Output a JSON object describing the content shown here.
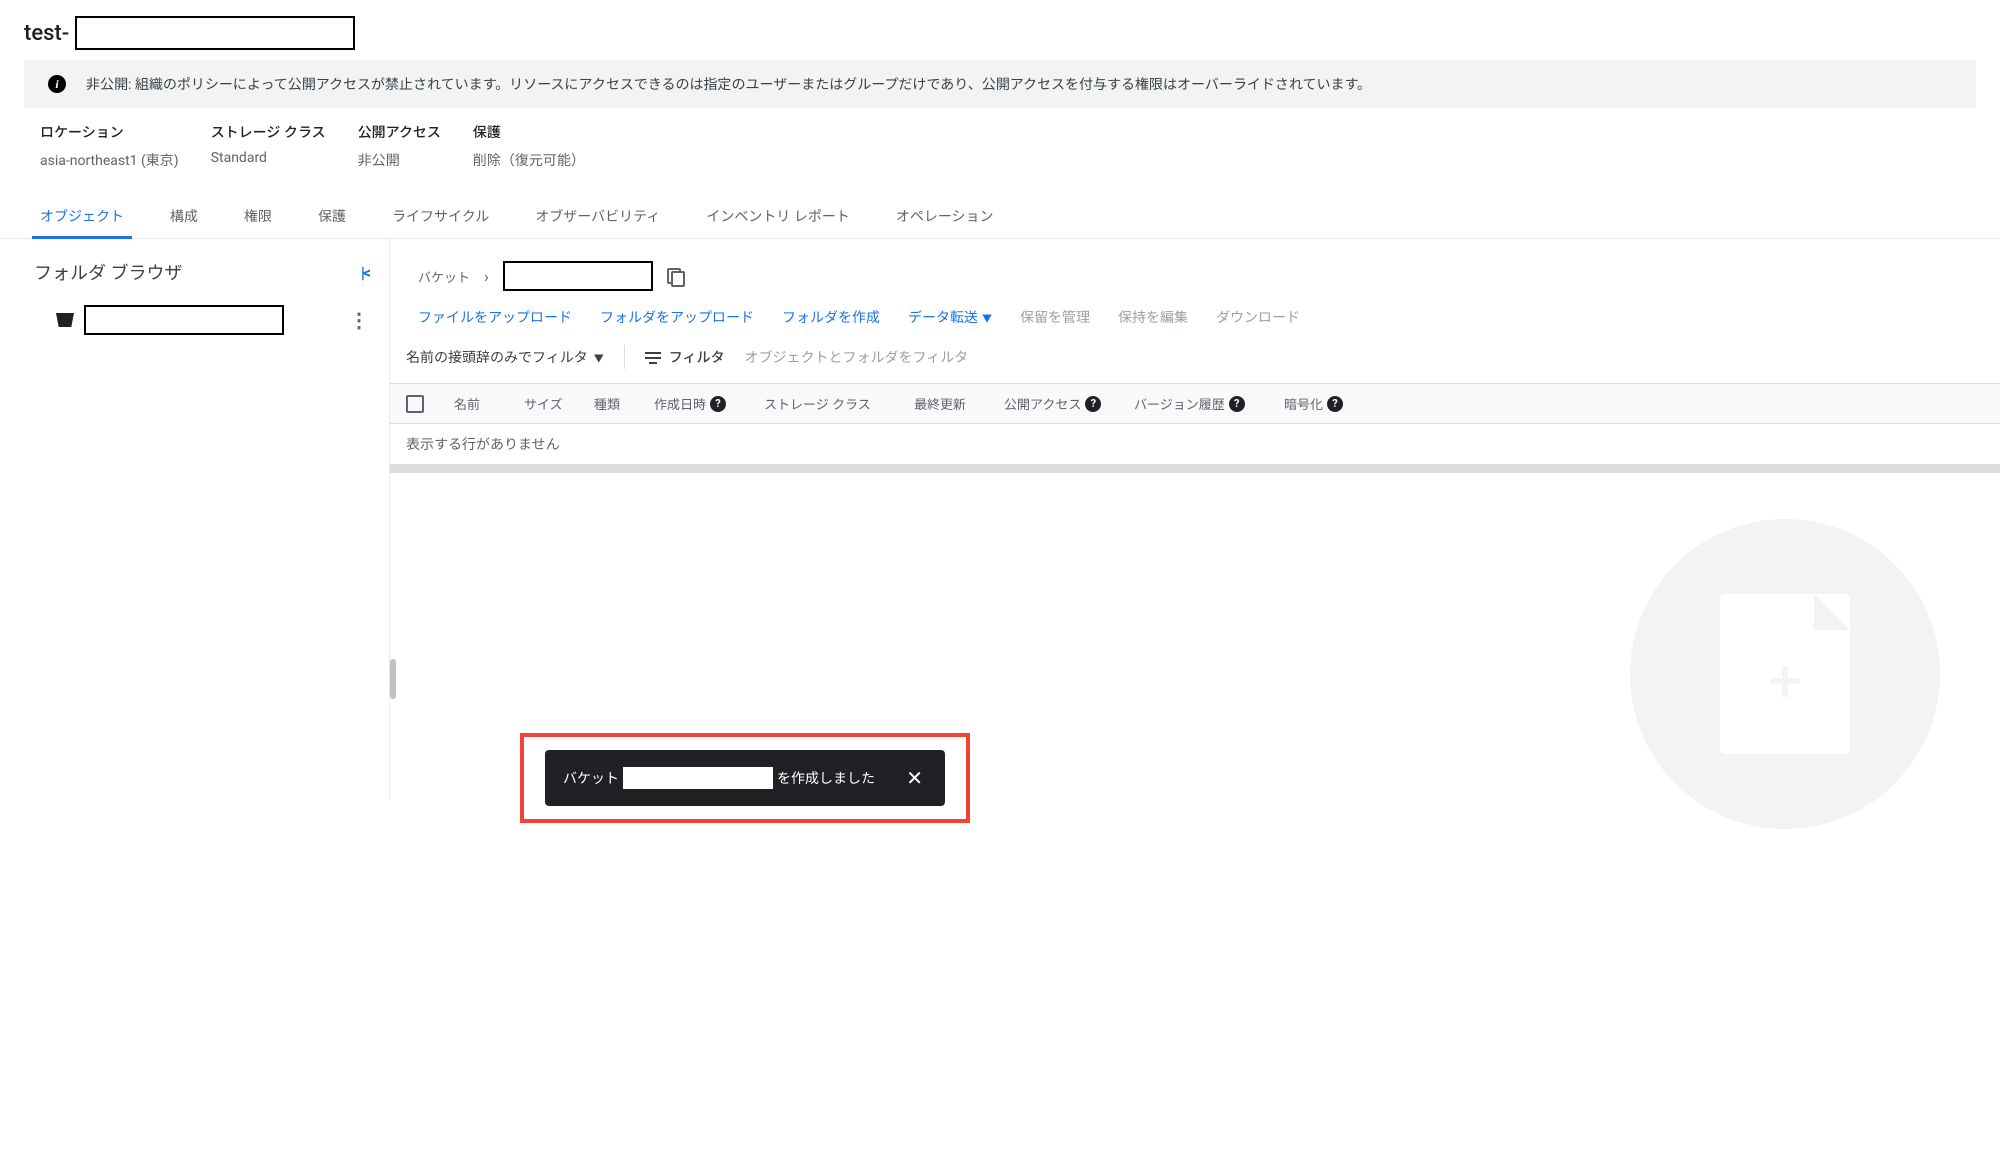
{
  "title_prefix": "test-",
  "info_banner": "非公開: 組織のポリシーによって公開アクセスが禁止されています。リソースにアクセスできるのは指定のユーザーまたはグループだけであり、公開アクセスを付与する権限はオーバーライドされています。",
  "meta": {
    "location": {
      "label": "ロケーション",
      "value": "asia-northeast1 (東京)"
    },
    "storage_class": {
      "label": "ストレージ クラス",
      "value": "Standard"
    },
    "public_access": {
      "label": "公開アクセス",
      "value": "非公開"
    },
    "protection": {
      "label": "保護",
      "value": "削除（復元可能）"
    }
  },
  "tabs": {
    "objects": "オブジェクト",
    "config": "構成",
    "permissions": "権限",
    "protection": "保護",
    "lifecycle": "ライフサイクル",
    "observability": "オブザーバビリティ",
    "inventory": "インベントリ レポート",
    "operations": "オペレーション"
  },
  "sidebar": {
    "title": "フォルダ ブラウザ"
  },
  "breadcrumb": {
    "label": "バケット"
  },
  "actions": {
    "upload_file": "ファイルをアップロード",
    "upload_folder": "フォルダをアップロード",
    "create_folder": "フォルダを作成",
    "transfer": "データ転送",
    "hold": "保留を管理",
    "retention": "保持を編集",
    "download": "ダウンロード"
  },
  "filter": {
    "dropdown": "名前の接頭辞のみでフィルタ",
    "label": "フィルタ",
    "placeholder": "オブジェクトとフォルダをフィルタ"
  },
  "columns": {
    "name": "名前",
    "size": "サイズ",
    "type": "種類",
    "created": "作成日時",
    "storage_class": "ストレージ クラス",
    "updated": "最終更新",
    "public_access": "公開アクセス",
    "version_history": "バージョン履歴",
    "encryption": "暗号化"
  },
  "empty_message": "表示する行がありません",
  "toast": {
    "prefix": "バケット",
    "suffix": "を作成しました"
  }
}
